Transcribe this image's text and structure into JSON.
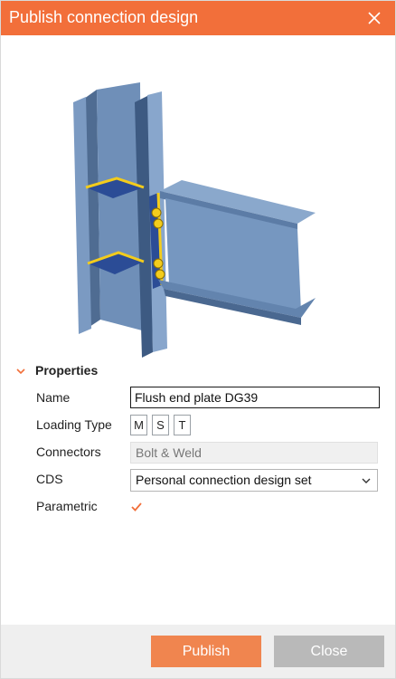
{
  "dialog": {
    "title": "Publish connection design"
  },
  "properties": {
    "header": "Properties",
    "name_label": "Name",
    "name_value": "Flush end plate DG39",
    "loading_type_label": "Loading Type",
    "loading_types": [
      "M",
      "S",
      "T"
    ],
    "connectors_label": "Connectors",
    "connectors_value": "Bolt & Weld",
    "cds_label": "CDS",
    "cds_value": "Personal connection design set",
    "parametric_label": "Parametric",
    "parametric_checked": true
  },
  "footer": {
    "publish_label": "Publish",
    "close_label": "Close"
  },
  "colors": {
    "accent": "#f26f3a",
    "steel": "#6d8fbb",
    "plate": "#2b4c96",
    "weld": "#f3cc1c"
  },
  "icons": {
    "close": "close-icon",
    "section_toggle": "chevron-down-icon",
    "dropdown": "chevron-down-icon",
    "checkbox": "checkmark-icon"
  }
}
